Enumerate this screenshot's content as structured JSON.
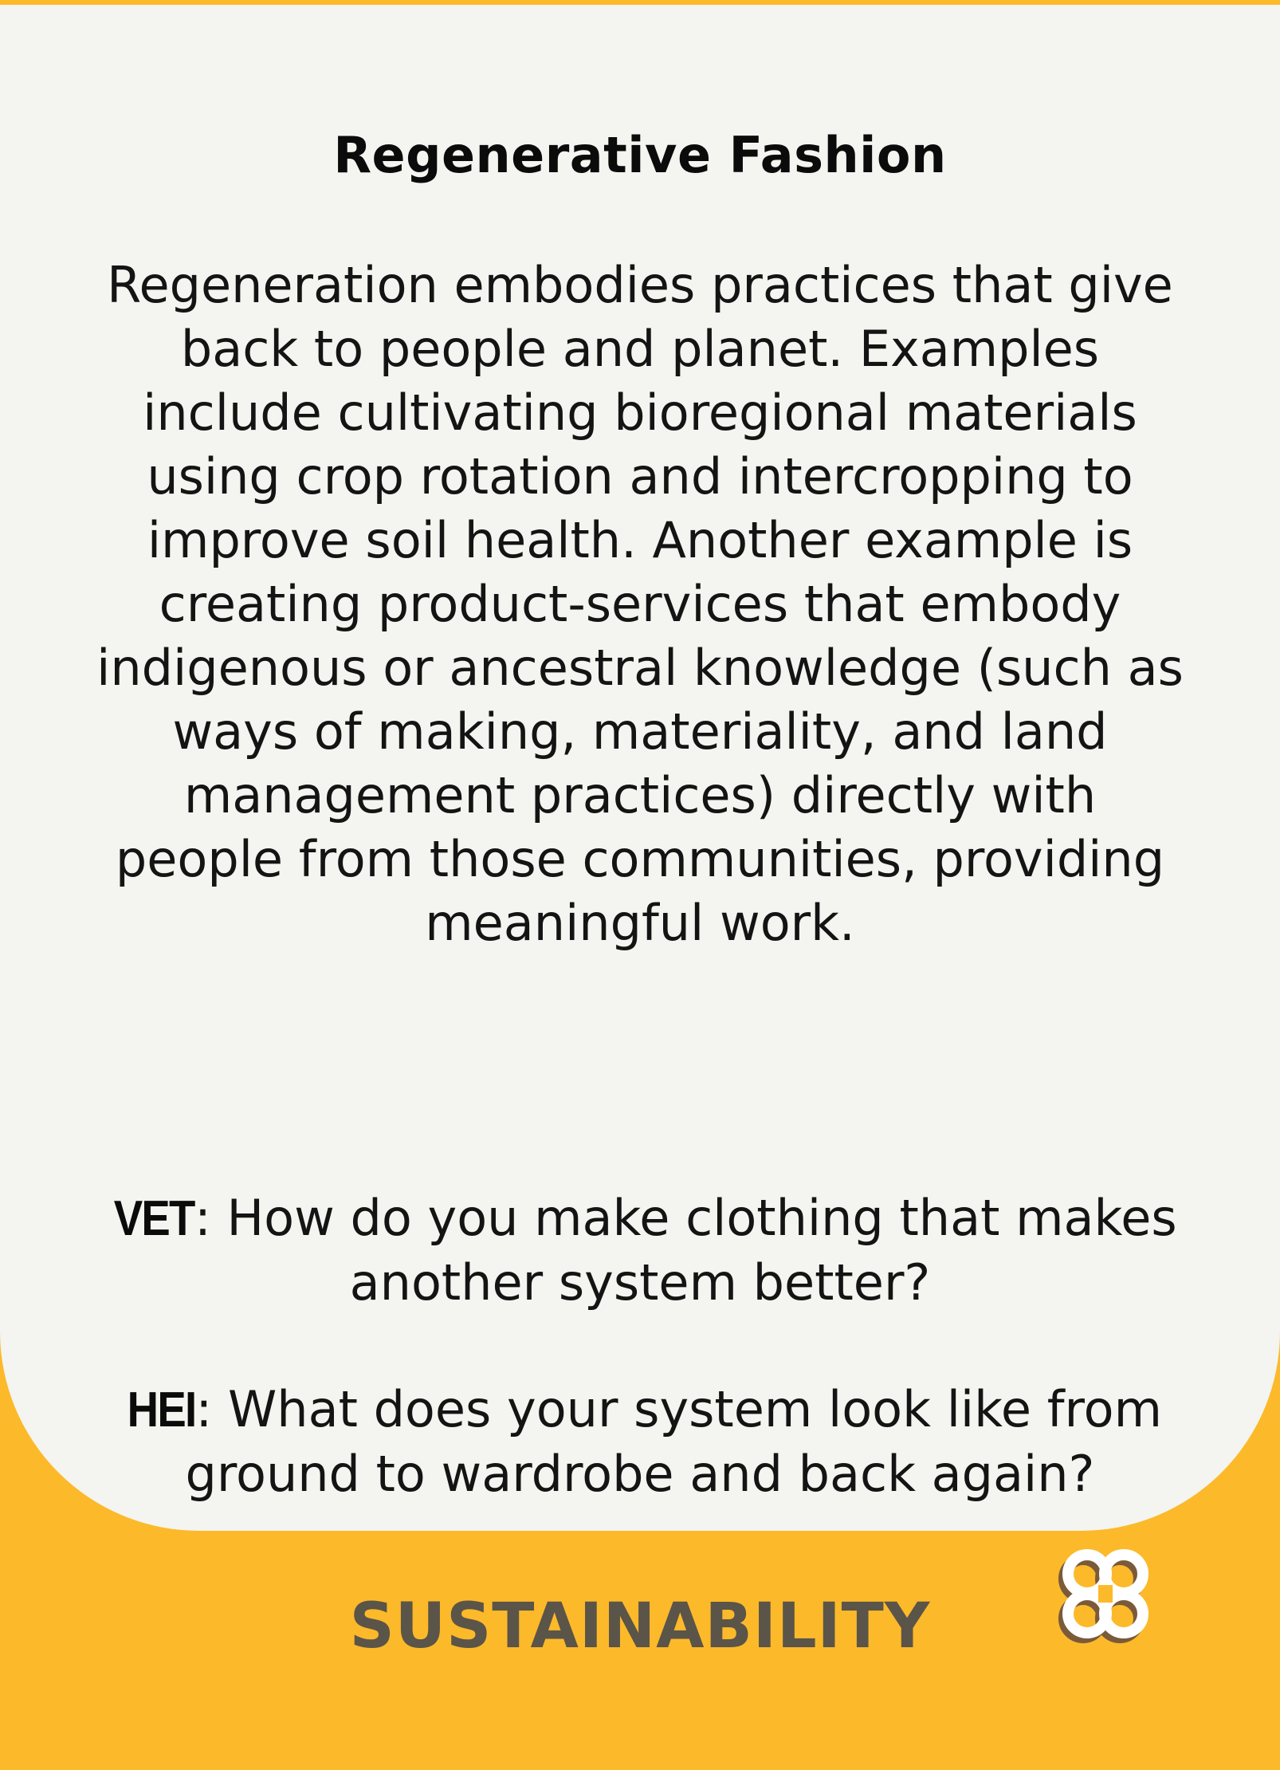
{
  "card": {
    "title": "Regenerative Fashion",
    "body": "Regeneration embodies practices that give back to people and planet. Examples include cultivating bioregional materials using crop rotation and intercropping to improve soil health. Another example is creating product-services that embody indigenous or ancestral knowledge (such as ways of making, materiality, and land management practices) directly with people from those communities, providing meaningful work.",
    "questions": [
      {
        "label": "VET",
        "text": ": How do you make clothing that makes another system better?"
      },
      {
        "label": "HEI",
        "text": ": What does your system look like from ground to wardrobe and back again?"
      }
    ],
    "category": "SUSTAINABILITY",
    "logo_icon": "interlocking-loops-logo-icon"
  },
  "colors": {
    "accent": "#fcb92a",
    "panel": "#f4f4f0",
    "text": "#141414",
    "category_text": "#5b5448",
    "logo_shadow": "#7a5a3a",
    "logo_fill": "#ffffff"
  }
}
